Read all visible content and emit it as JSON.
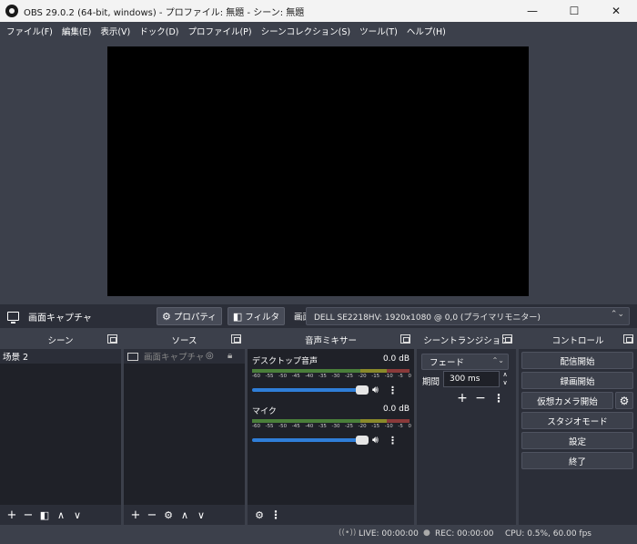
{
  "titlebar": {
    "title": "OBS 29.0.2 (64-bit, windows) - プロファイル: 無題 - シーン: 無題",
    "minimize": "—",
    "maximize": "☐",
    "close": "✕"
  },
  "menu": [
    "ファイル(F)",
    "編集(E)",
    "表示(V)",
    "ドック(D)",
    "プロファイル(P)",
    "シーンコレクション(S)",
    "ツール(T)",
    "ヘルプ(H)"
  ],
  "infobar": {
    "source_name": "画面キャプチャ",
    "properties_label": "プロパティ",
    "filters_label": "フィルタ",
    "screen_label": "画面",
    "display_value": "DELL SE2218HV: 1920x1080 @ 0,0 (プライマリモニター)"
  },
  "scenes": {
    "header": "シーン",
    "items": [
      "场景 2"
    ]
  },
  "sources": {
    "header": "ソース",
    "items": [
      "画面キャプチャ"
    ]
  },
  "mixer": {
    "header": "音声ミキサー",
    "channels": [
      {
        "name": "デスクトップ音声",
        "level": "0.0 dB",
        "volume": 0.87
      },
      {
        "name": "マイク",
        "level": "0.0 dB",
        "volume": 0.87
      }
    ],
    "ticks": [
      "-60",
      "-55",
      "-50",
      "-45",
      "-40",
      "-35",
      "-30",
      "-25",
      "-20",
      "-15",
      "-10",
      "-5",
      "0"
    ]
  },
  "transitions": {
    "header": "シーントランジション",
    "selected": "フェード",
    "duration_label": "期間",
    "duration_value": "300 ms"
  },
  "controls": {
    "header": "コントロール",
    "start_streaming": "配信開始",
    "start_recording": "録画開始",
    "start_virtual_camera": "仮想カメラ開始",
    "studio_mode": "スタジオモード",
    "settings": "設定",
    "exit": "終了"
  },
  "status": {
    "live": "LIVE: 00:00:00",
    "rec": "REC: 00:00:00",
    "cpu": "CPU: 0.5%, 60.00 fps"
  },
  "colors": {
    "background": "#3c404b",
    "dock": "#2b2e38",
    "volume": "#2f7ed8"
  }
}
